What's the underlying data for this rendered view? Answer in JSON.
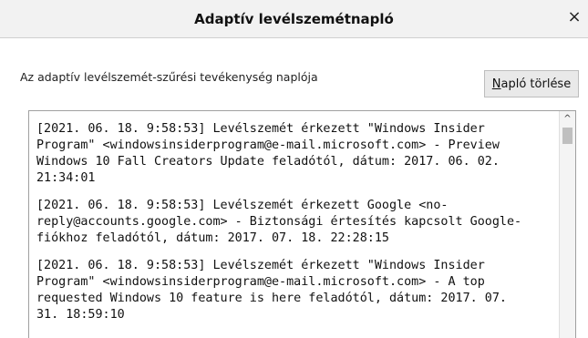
{
  "dialog": {
    "title": "Adaptív levélszemétnapló",
    "close_glyph": "×"
  },
  "description": "Az adaptív levélszemét-szűrési tevékenység naplója",
  "clear_button": {
    "label_hotkey": "N",
    "label_rest": "apló törlése"
  },
  "log_entries": [
    "[2021. 06. 18. 9:58:53] Levélszemét érkezett \"Windows Insider\nProgram\" <windowsinsiderprogram@e-mail.microsoft.com> - Preview\nWindows 10 Fall Creators Update feladótól, dátum: 2017. 06. 02.\n21:34:01",
    "[2021. 06. 18. 9:58:53] Levélszemét érkezett Google <no-\nreply@accounts.google.com> - Biztonsági értesítés kapcsolt Google-\nfiókhoz feladótól, dátum: 2017. 07. 18. 22:28:15",
    "[2021. 06. 18. 9:58:53] Levélszemét érkezett \"Windows Insider\nProgram\" <windowsinsiderprogram@e-mail.microsoft.com> - A top\nrequested Windows 10 feature is here feladótól, dátum: 2017. 07.\n31. 18:59:10"
  ],
  "scrollbar": {
    "up_arrow_glyph": "^"
  }
}
